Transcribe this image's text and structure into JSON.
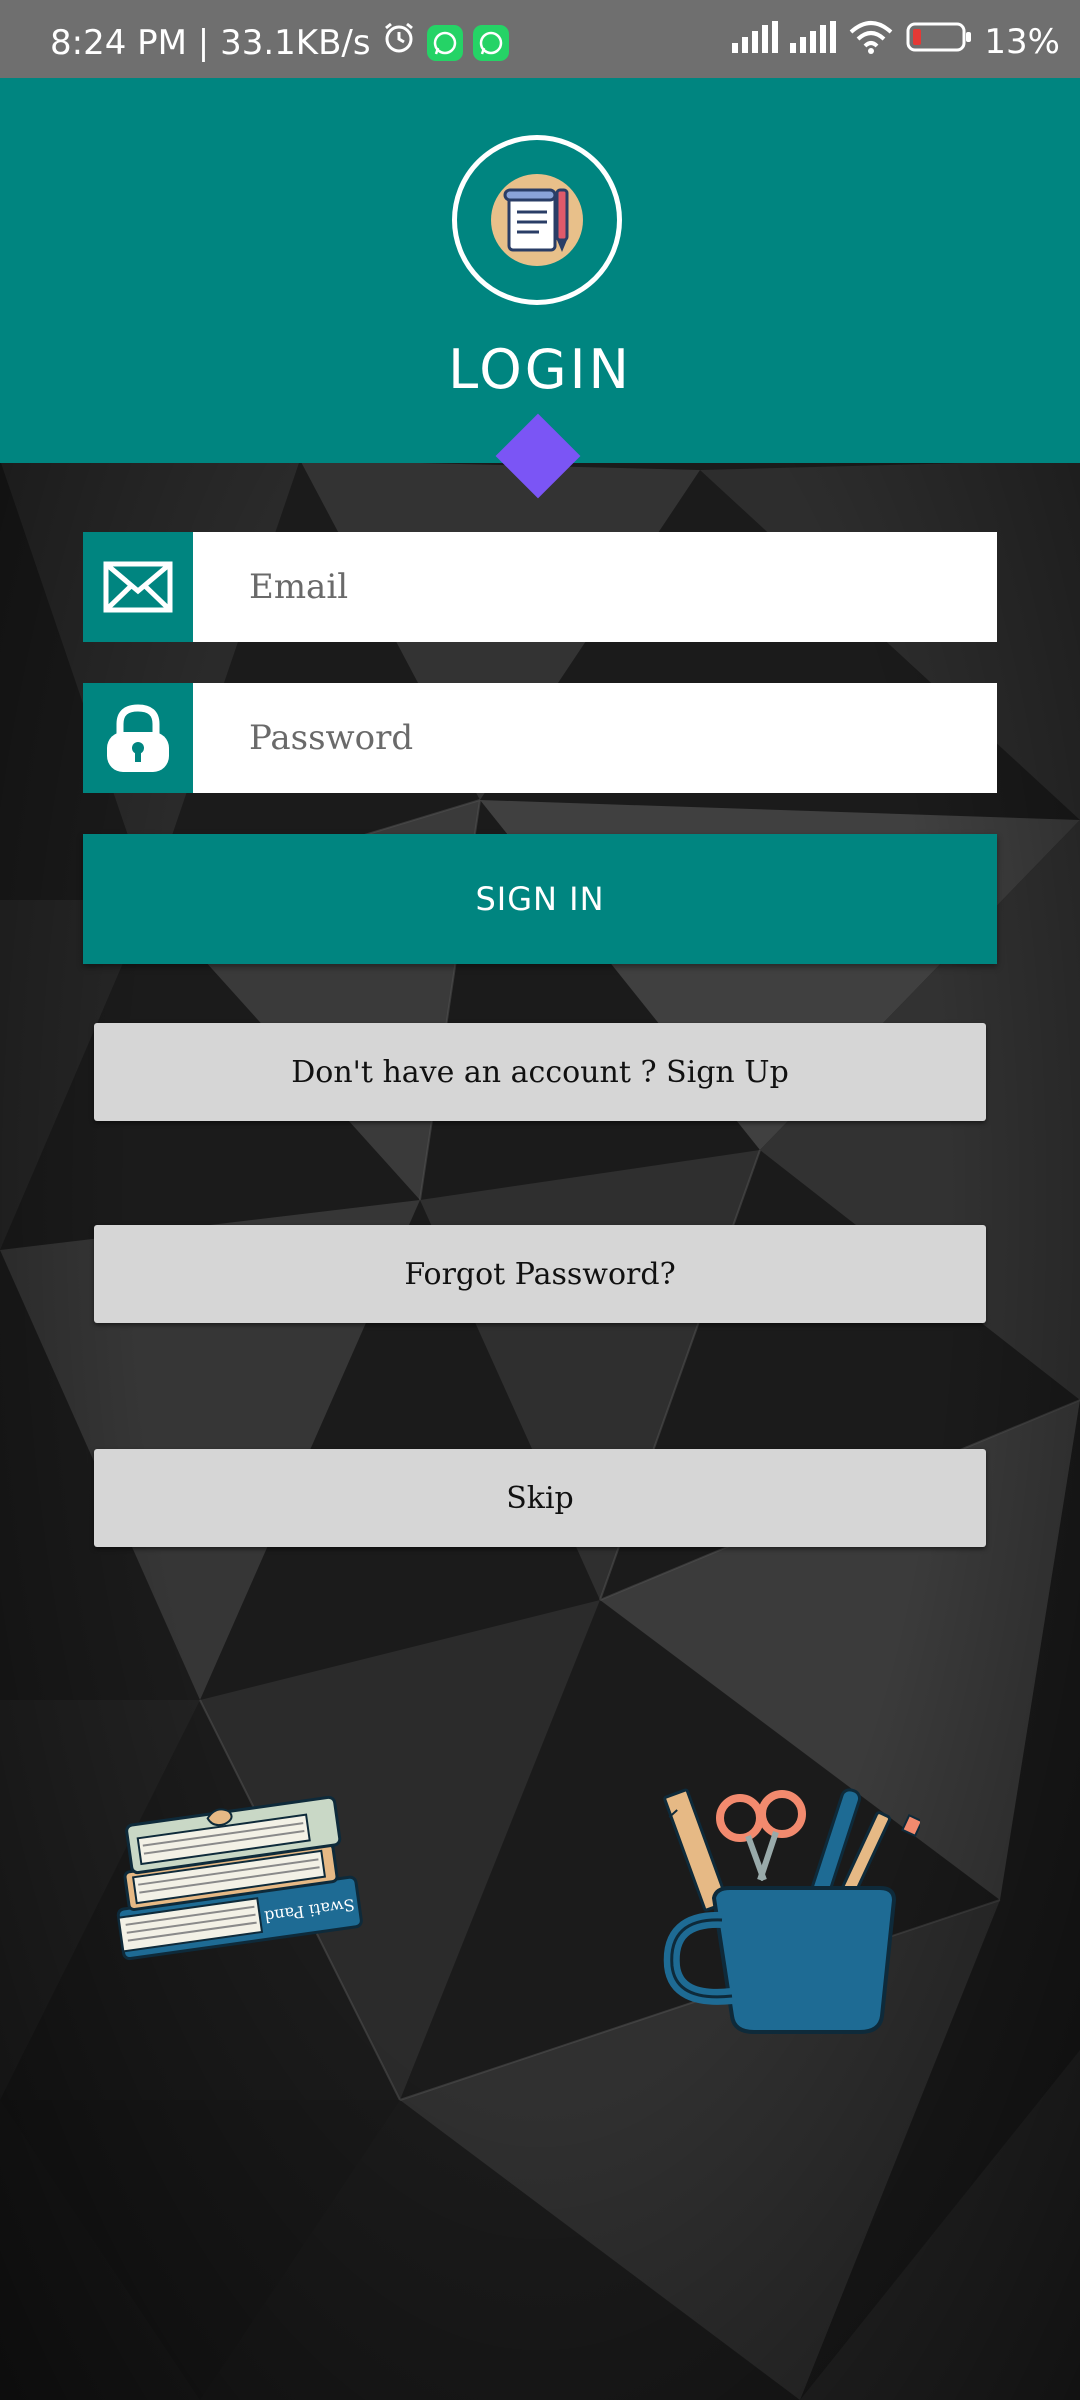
{
  "status_bar": {
    "time_speed": "8:24 PM | 33.1KB/s",
    "battery": "13%"
  },
  "header": {
    "title": "LOGIN",
    "logo_icon": "notepad-pencil-icon"
  },
  "form": {
    "email_placeholder": "Email",
    "password_placeholder": "Password",
    "signin_label": "SIGN IN"
  },
  "links": {
    "signup_label": "Don't have an account ? Sign Up",
    "forgot_label": "Forgot Password?",
    "skip_label": "Skip"
  },
  "illustrations": {
    "books_text": "Swati Pand"
  },
  "colors": {
    "teal": "#008580",
    "accent_purple": "#7b55f5",
    "button_grey": "#d6d6d6"
  }
}
